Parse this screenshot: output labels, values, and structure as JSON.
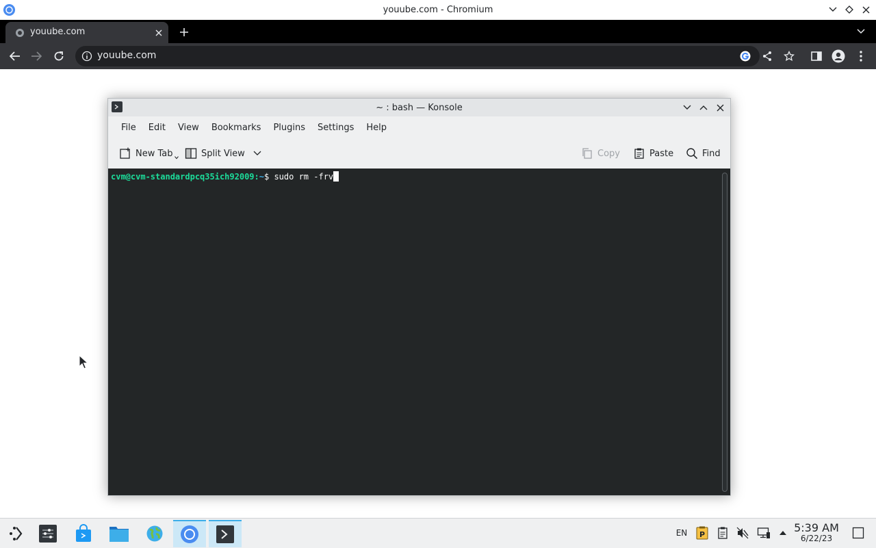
{
  "browser": {
    "window_title": "youube.com - Chromium",
    "tab_title": "youube.com",
    "url": "youube.com"
  },
  "konsole": {
    "window_title": "~ : bash — Konsole",
    "menu": [
      "File",
      "Edit",
      "View",
      "Bookmarks",
      "Plugins",
      "Settings",
      "Help"
    ],
    "toolbar": {
      "new_tab": "New Tab",
      "split_view": "Split View",
      "copy": "Copy",
      "paste": "Paste",
      "find": "Find"
    },
    "terminal": {
      "user_host": "cvm@cvm-standardpcq35ich92009",
      "path": "~",
      "prompt_symbol": "$",
      "command": " sudo rm -frv"
    }
  },
  "taskbar": {
    "keyboard_layout": "EN",
    "time": "5:39 AM",
    "date": "6/22/23"
  },
  "colors": {
    "terminal_bg": "#232627",
    "prompt_user": "#1cdc9a",
    "prompt_path": "#3daee9",
    "chrome_toolbar": "#35363a",
    "taskbar_active": "#3daee9"
  }
}
